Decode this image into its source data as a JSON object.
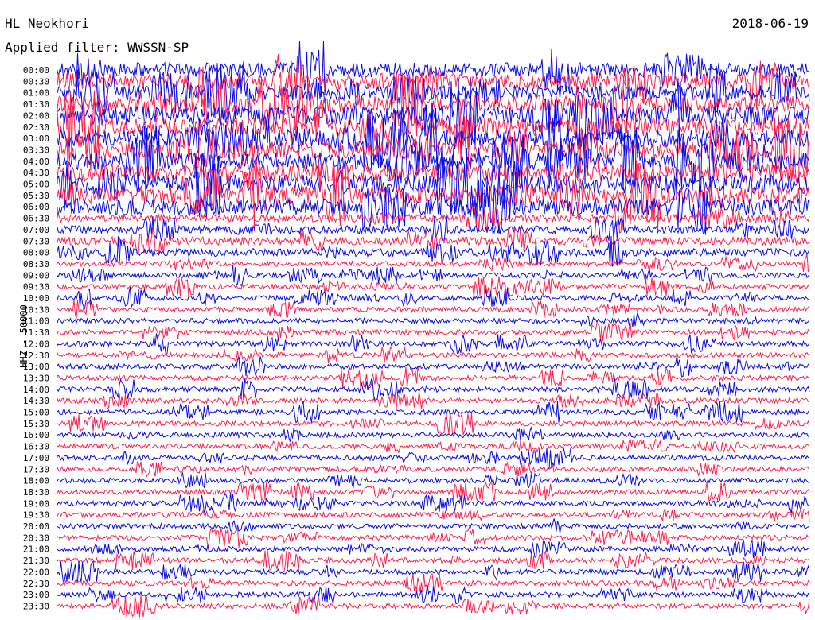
{
  "header": {
    "station": "HL Neokhori",
    "filter": "Applied filter: WWSSN-SP",
    "date": "2018-06-19"
  },
  "channel_label": "HHZ - 50000",
  "colors": {
    "red": "#ff2050",
    "blue": "#0a0ae6"
  },
  "chart_data": {
    "type": "line",
    "rows": [
      "00:00",
      "00:30",
      "01:00",
      "01:30",
      "02:00",
      "02:30",
      "03:00",
      "03:30",
      "04:00",
      "04:30",
      "05:00",
      "05:30",
      "06:00",
      "06:30",
      "07:00",
      "07:30",
      "08:00",
      "08:30",
      "09:00",
      "09:30",
      "10:00",
      "10:30",
      "11:00",
      "11:30",
      "12:00",
      "12:30",
      "13:00",
      "13:30",
      "14:00",
      "14:30",
      "15:00",
      "15:30",
      "16:00",
      "16:30",
      "17:00",
      "17:30",
      "18:00",
      "18:30",
      "19:00",
      "19:30",
      "20:00",
      "20:30",
      "21:00",
      "21:30",
      "22:00",
      "22:30",
      "23:00",
      "23:30"
    ],
    "row_colors": [
      "blue",
      "red",
      "blue",
      "red",
      "blue",
      "red",
      "blue",
      "red",
      "blue",
      "red",
      "blue",
      "red",
      "blue",
      "red",
      "blue",
      "red",
      "blue",
      "red",
      "blue",
      "red",
      "blue",
      "red",
      "blue",
      "red",
      "blue",
      "red",
      "blue",
      "red",
      "blue",
      "red",
      "blue",
      "red",
      "blue",
      "red",
      "blue",
      "red",
      "blue",
      "red",
      "blue",
      "red",
      "blue",
      "red",
      "blue",
      "red",
      "blue",
      "red",
      "blue",
      "red"
    ],
    "ylabel": "HHZ - 50000"
  }
}
